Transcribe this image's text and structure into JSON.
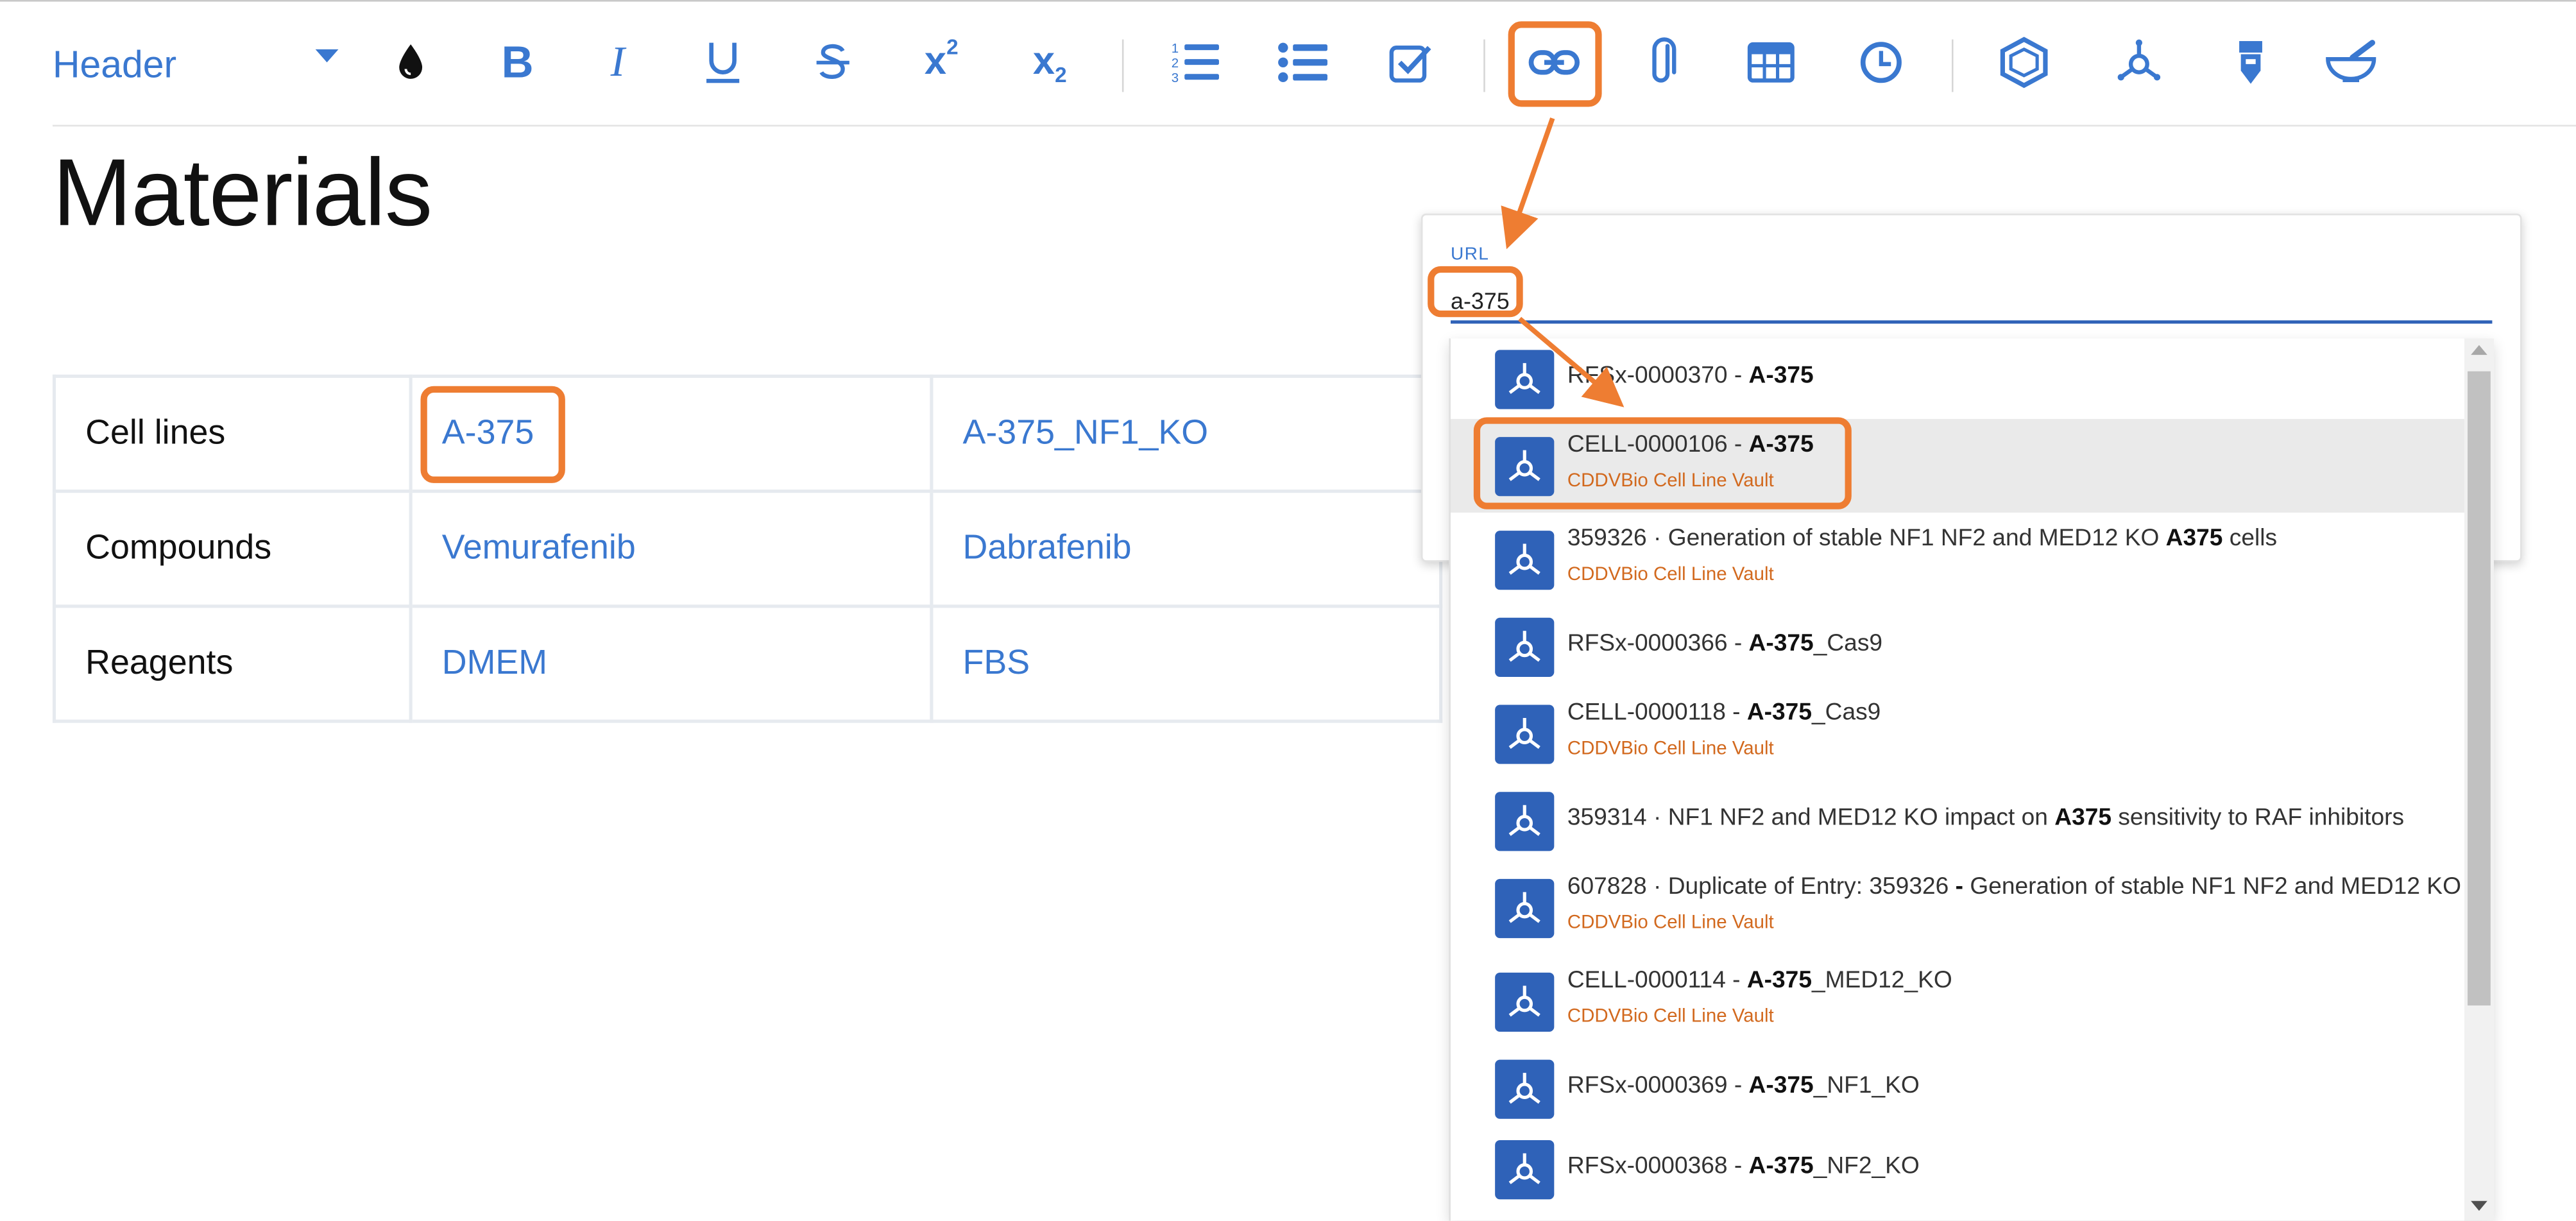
{
  "toolbar": {
    "block_format": "Header",
    "buttons": [
      "ink-drop-icon",
      "bold-icon",
      "italic-icon",
      "underline-icon",
      "strikethrough-icon",
      "superscript-icon",
      "subscript-icon",
      "numbered-list-icon",
      "bulleted-list-icon",
      "checklist-icon",
      "link-icon",
      "attachment-icon",
      "table-icon",
      "clock-icon",
      "hexagon-icon",
      "molecule-icon",
      "sample-tube-icon",
      "mortar-pestle-icon"
    ],
    "highlighted_button": "link-icon"
  },
  "page": {
    "title": "Materials"
  },
  "table": {
    "rows": [
      {
        "label": "Cell lines",
        "c1": "A-375",
        "c2": "A-375_NF1_KO"
      },
      {
        "label": "Compounds",
        "c1": "Vemurafenib",
        "c2": "Dabrafenib"
      },
      {
        "label": "Reagents",
        "c1": "DMEM",
        "c2": "FBS"
      }
    ]
  },
  "url_dialog": {
    "label": "URL",
    "value": "a-375"
  },
  "results": [
    {
      "prefix": "RFSx-0000370 - ",
      "bold": "A-375",
      "suffix": "",
      "source": ""
    },
    {
      "prefix": "CELL-0000106 - ",
      "bold": "A-375",
      "suffix": "",
      "source": "CDDVBio Cell Line Vault"
    },
    {
      "prefix": "359326 · Generation of stable NF1 NF2 and MED12 KO ",
      "bold": "A375",
      "suffix": " cells",
      "source": "CDDVBio Cell Line Vault"
    },
    {
      "prefix": "RFSx-0000366 - ",
      "bold": "A-375",
      "suffix": "_Cas9",
      "source": ""
    },
    {
      "prefix": "CELL-0000118 - ",
      "bold": "A-375",
      "suffix": "_Cas9",
      "source": "CDDVBio Cell Line Vault"
    },
    {
      "prefix": "359314 · NF1 NF2 and MED12 KO impact on ",
      "bold": "A375",
      "suffix": " sensitivity to RAF inhibitors",
      "source": ""
    },
    {
      "prefix": "607828 · Duplicate of Entry: 359326 ",
      "bold": "-",
      "suffix": " Generation of stable NF1 NF2 and MED12 KO",
      "source": "CDDVBio Cell Line Vault"
    },
    {
      "prefix": "CELL-0000114 - ",
      "bold": "A-375",
      "suffix": "_MED12_KO",
      "source": "CDDVBio Cell Line Vault"
    },
    {
      "prefix": "RFSx-0000369 - ",
      "bold": "A-375",
      "suffix": "_NF1_KO",
      "source": ""
    },
    {
      "prefix": "RFSx-0000368 - ",
      "bold": "A-375",
      "suffix": "_NF2_KO",
      "source": ""
    }
  ],
  "selected_result_index": 1,
  "colors": {
    "accent": "#3a78d0",
    "highlight": "#ee7d32",
    "icon_bg": "#2f62b8",
    "source_text": "#d2691e"
  }
}
